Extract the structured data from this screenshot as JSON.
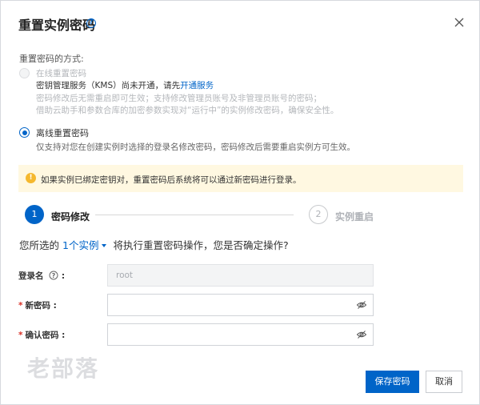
{
  "dialog": {
    "title": "重置实例密码",
    "help_glyph": "?",
    "close_glyph": "×"
  },
  "method": {
    "label": "重置密码的方式:",
    "online": {
      "label": "在线重置密码",
      "kms_text": "密钥管理服务（KMS）尚未开通，请先",
      "kms_link": "开通服务",
      "note1": "密码修改后无需重启即可生效；支持修改管理员账号及非管理员账号的密码；",
      "note2": "借助云助手和参数合库的加密参数实现对“运行中”的实例修改密码，确保安全性。"
    },
    "offline": {
      "label": "离线重置密码",
      "note": "仅支持对您在创建实例时选择的登录名修改密码，密码修改后需要重启实例方可生效。"
    }
  },
  "warning": {
    "icon_glyph": "!",
    "text": "如果实例已绑定密钥对，重置密码后系统将可以通过新密码进行登录。"
  },
  "steps": [
    {
      "number": "1",
      "label": "密码修改"
    },
    {
      "number": "2",
      "label": "实例重启"
    }
  ],
  "confirm": {
    "prefix": "您所选的",
    "link": "1个实例",
    "suffix": "将执行重置密码操作，您是否确定操作?"
  },
  "form": {
    "login": {
      "label": "登录名",
      "value": "root",
      "colon": ":"
    },
    "new_password": {
      "required": "*",
      "label": "新密码",
      "colon": ":",
      "value": ""
    },
    "confirm_password": {
      "required": "*",
      "label": "确认密码",
      "colon": ":",
      "value": ""
    }
  },
  "watermark": "老部落",
  "buttons": {
    "save": "保存密码",
    "cancel": "取消"
  },
  "colors": {
    "accent": "#0064c8",
    "warning_bg": "#fff8e1",
    "warning_icon": "#f5b82e",
    "required": "#d93026"
  }
}
